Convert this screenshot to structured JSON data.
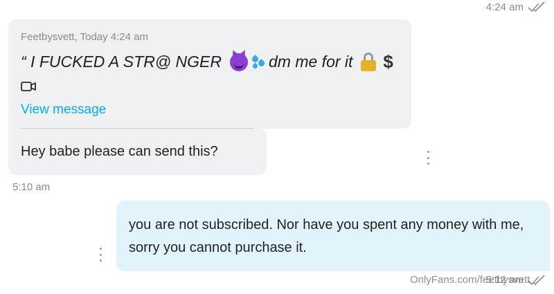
{
  "header": {
    "time": "4:24 am"
  },
  "quoted_message": {
    "sender_meta": "Feetbysvett, Today 4:24 am",
    "text_part1": "“ I FUCKED A STR@ NGER",
    "text_part2": "dm me for it",
    "dollar_sign": "$",
    "emojis": [
      "smiling-devil-emoji",
      "sweat-droplets-emoji",
      "lock-emoji"
    ],
    "view_link": "View message"
  },
  "incoming_message": {
    "text": "Hey babe please can send this?",
    "time": "5:10 am"
  },
  "outgoing_message": {
    "text": "you are not subscribed. Nor have you spent any money with me, sorry you cannot purchase it.",
    "time": "5:12 am"
  },
  "watermark": "OnlyFans.com/feetbysvett",
  "colors": {
    "accent": "#00aff0",
    "incoming_bubble": "#eff0f2",
    "outgoing_bubble": "#e3f3fb"
  }
}
